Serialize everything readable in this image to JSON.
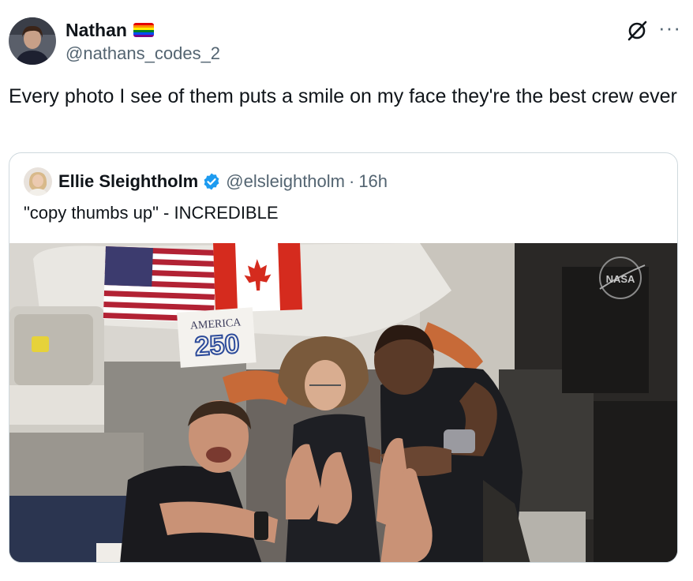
{
  "author": {
    "name": "Nathan",
    "handle": "@nathans_codes_2",
    "name_badge_icon": "rainbow-flag-icon"
  },
  "actions": {
    "grok_icon": "grok-icon",
    "more_label": "···"
  },
  "post": {
    "text": "Every photo I see of them puts a smile on my face they're the best crew ever"
  },
  "quoted": {
    "name": "Ellie Sleightholm",
    "verified_icon": "verified-badge-icon",
    "handle": "@elsleightholm",
    "separator": "·",
    "time": "16h",
    "text": "\"copy thumbs up\" - INCREDIBLE",
    "media": {
      "banner_text_top": "AMERICA",
      "banner_text_num": "250",
      "watermark": "NASA"
    }
  },
  "colors": {
    "verified_blue": "#1d9bf0",
    "text_primary": "#0f1419",
    "text_secondary": "#536471",
    "border": "#cfd9de"
  }
}
